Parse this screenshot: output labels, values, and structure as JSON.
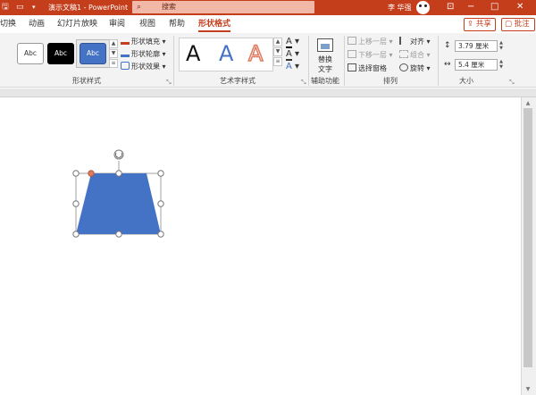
{
  "app": {
    "doc_title": "演示文稿1 - PowerPoint",
    "search_placeholder": "搜索",
    "user_name": "李 华强"
  },
  "tabs": [
    {
      "label": "切换",
      "active": false
    },
    {
      "label": "动画",
      "active": false
    },
    {
      "label": "幻灯片放映",
      "active": false
    },
    {
      "label": "审阅",
      "active": false
    },
    {
      "label": "视图",
      "active": false
    },
    {
      "label": "帮助",
      "active": false
    },
    {
      "label": "形状格式",
      "active": true
    }
  ],
  "actions": {
    "share": "共享",
    "comment": "批注"
  },
  "ribbon": {
    "shape_styles": {
      "label": "形状样式",
      "swatches": [
        "Abc",
        "Abc",
        "Abc"
      ],
      "fill": "形状填充",
      "outline": "形状轮廓",
      "effects": "形状效果"
    },
    "wordart": {
      "label": "艺术字样式",
      "letters": [
        "A",
        "A",
        "A"
      ]
    },
    "accessibility": {
      "label": "辅助功能",
      "alt_text_line1": "替换",
      "alt_text_line2": "文字"
    },
    "arrange": {
      "label": "排列",
      "bring_forward": "上移一层",
      "send_backward": "下移一层",
      "selection_pane": "选择窗格",
      "align": "对齐",
      "group": "组合",
      "rotate": "旋转"
    },
    "size": {
      "label": "大小",
      "height": "3.79 厘米",
      "width": "5.4 厘米"
    }
  },
  "colors": {
    "accent": "#c43e1c",
    "shape_fill": "#4472c4",
    "handle_adjust": "#e07a5f"
  }
}
